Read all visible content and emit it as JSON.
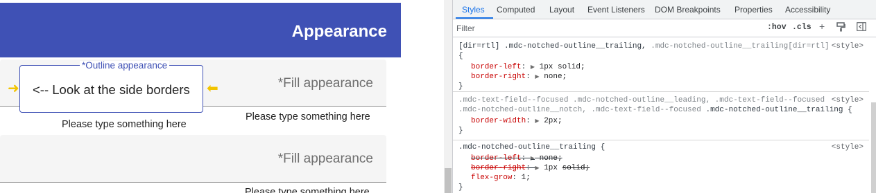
{
  "page": {
    "appbar_title": "Appearance",
    "outline_field": {
      "label": "*Outline appearance",
      "text": "<-- Look at the side borders",
      "helper": "Please type something here",
      "arrow_left": "➜",
      "arrow_right": "⬅"
    },
    "fill_fields": [
      {
        "label": "*Fill appearance",
        "helper": "Please type something here"
      },
      {
        "label": "*Fill appearance",
        "helper": "Please type something here"
      }
    ]
  },
  "devtools": {
    "tabs": [
      "Styles",
      "Computed",
      "Layout",
      "Event Listeners",
      "DOM Breakpoints",
      "Properties",
      "Accessibility"
    ],
    "active_tab": "Styles",
    "filter_placeholder": "Filter",
    "hov_label": ":hov",
    "cls_label": ".cls",
    "rules": [
      {
        "selector_main": "[dir=rtl] .mdc-notched-outline__trailing, ",
        "selector_dim": ".mdc-notched-outline__trailing[dir=rtl]",
        "source": "<style>",
        "open": "{",
        "props": [
          {
            "name": "border-left",
            "value": "1px solid;"
          },
          {
            "name": "border-right",
            "value": "none;"
          }
        ],
        "close": "}"
      },
      {
        "selector_line1": ".mdc-text-field--focused .mdc-notched-outline__leading, .mdc-text-field--focused",
        "selector_line2": ".mdc-notched-outline__notch, .mdc-text-field--focused .mdc-notched-outline__trailing {",
        "source": "<style>",
        "props": [
          {
            "name": "border-width",
            "value": "2px;"
          }
        ],
        "close": "}"
      },
      {
        "selector": ".mdc-notched-outline__trailing {",
        "source": "<style>",
        "props": [
          {
            "name": "border-left",
            "value": "none;"
          },
          {
            "name": "border-right",
            "value": "1px solid;"
          },
          {
            "name": "flex-grow",
            "value": "1;"
          }
        ],
        "close": "}"
      }
    ]
  },
  "colors": {
    "appbar": "#3f51b5",
    "accent_blue": "#1a73e8",
    "css_property": "#c80000",
    "arrow_yellow": "#f2c400"
  }
}
